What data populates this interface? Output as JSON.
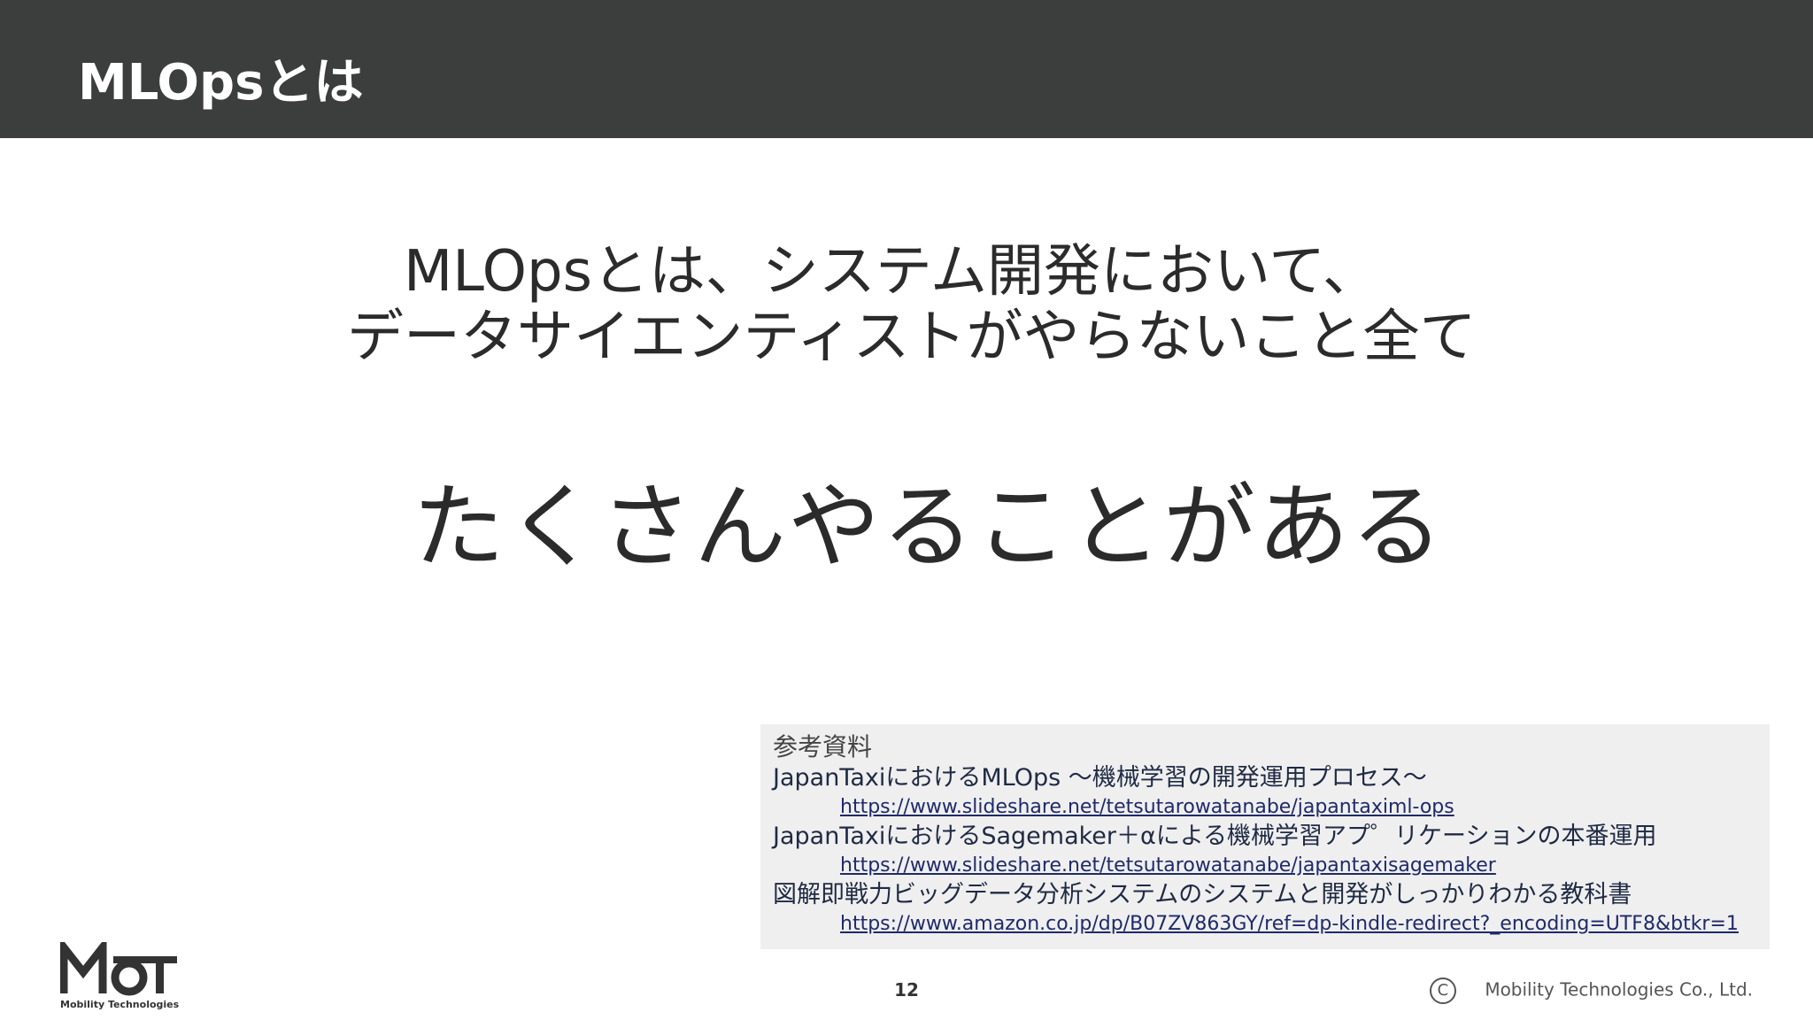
{
  "header": {
    "title": "MLOpsとは"
  },
  "definition": {
    "line1": "MLOpsとは、システム開発において、",
    "line2": "データサイエンティストがやらないこと全て"
  },
  "message": "たくさんやることがある",
  "references": {
    "heading": "参考資料",
    "items": [
      {
        "title": "JapanTaxiにおけるMLOps 〜機械学習の開発運用プロセス〜",
        "url": "https://www.slideshare.net/tetsutarowatanabe/japantaximl-ops"
      },
      {
        "title": "JapanTaxiにおけるSagemaker＋αによる機械学習アプ゜リケーションの本番運用",
        "url": "https://www.slideshare.net/tetsutarowatanabe/japantaxisagemaker"
      },
      {
        "title": "図解即戦力ビッグデータ分析システムのシステムと開発がしっかりわかる教科書",
        "url": "https://www.amazon.co.jp/dp/B07ZV863GY/ref=dp-kindle-redirect?_encoding=UTF8&btkr=1"
      }
    ]
  },
  "footer": {
    "logo_text": "Mobility Technologies",
    "page_number": "12",
    "copyright_symbol": "C",
    "copyright_text": "Mobility Technologies Co., Ltd."
  },
  "colors": {
    "header_bg": "#3b3e3c",
    "refs_bg": "#efefef",
    "link": "#1f2a6b"
  }
}
